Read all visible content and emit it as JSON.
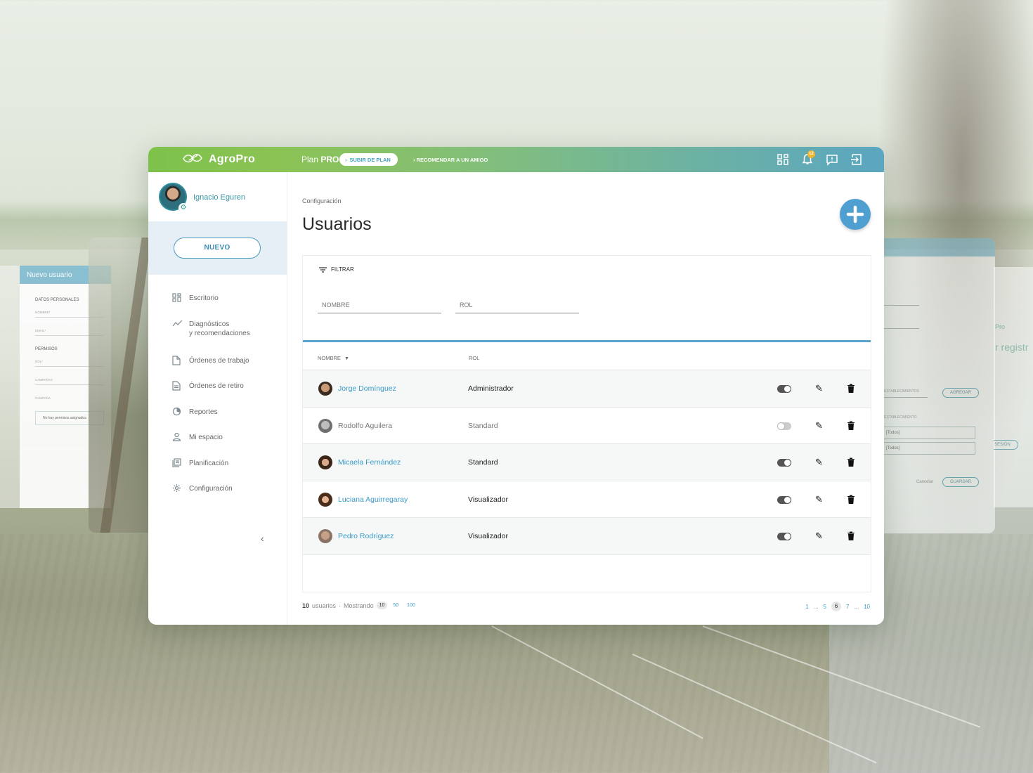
{
  "app": {
    "brand": "AgroPro",
    "plan_prefix": "Plan",
    "plan_name": "PRO",
    "upgrade_label": "SUBIR DE PLAN",
    "recommend_label": "RECOMENDAR A UN AMIGO",
    "notifications_count": "12"
  },
  "user": {
    "name": "Ignacio Eguren"
  },
  "sidebar": {
    "new_label": "NUEVO",
    "items": [
      {
        "label": "Escritorio",
        "icon": "dashboard-icon"
      },
      {
        "label": "Diagnósticos",
        "label2": "y recomendaciones",
        "icon": "trend-icon"
      },
      {
        "label": "Órdenes de trabajo",
        "icon": "document-icon"
      },
      {
        "label": "Órdenes de retiro",
        "icon": "document-list-icon"
      },
      {
        "label": "Reportes",
        "icon": "chart-pie-icon"
      },
      {
        "label": "Mi espacio",
        "icon": "person-icon"
      },
      {
        "label": "Planificación",
        "icon": "planning-icon"
      },
      {
        "label": "Configuración",
        "icon": "gear-icon"
      }
    ],
    "collapse_glyph": "‹"
  },
  "page": {
    "breadcrumb": "Configuración",
    "title": "Usuarios"
  },
  "filter": {
    "label": "FILTRAR",
    "name_placeholder": "NOMBRE",
    "role_placeholder": "ROL"
  },
  "table": {
    "col_name": "NOMBRE",
    "col_role": "ROL",
    "rows": [
      {
        "name": "Jorge Domínguez",
        "role": "Administrador",
        "active": true,
        "face": "#7a5a44"
      },
      {
        "name": "Rodolfo Aguilera",
        "role": "Standard",
        "active": false,
        "face": "#9a9a9a"
      },
      {
        "name": "Micaela Fernández",
        "role": "Standard",
        "active": true,
        "face": "#5b3b2c"
      },
      {
        "name": "Luciana Aguirregaray",
        "role": "Visualizador",
        "active": true,
        "face": "#6b4a35"
      },
      {
        "name": "Pedro Rodríguez",
        "role": "Visualizador",
        "active": true,
        "face": "#8d7665"
      }
    ]
  },
  "footer": {
    "total": "10",
    "total_label": "usuarios",
    "separator": "·",
    "showing_label": "Mostrando",
    "page_sizes": [
      "10",
      "50",
      "100"
    ],
    "pages": [
      "1",
      "...",
      "5",
      "6",
      "7",
      "...",
      "10"
    ],
    "current_page": "6"
  },
  "ghost": {
    "left_title": "Nuevo usuario",
    "left_section1": "DATOS PERSONALES",
    "left_f1": "NOMBRE*",
    "left_f2": "EMAIL*",
    "left_section2": "PERMISOS",
    "left_f3": "ROL*",
    "left_f4": "CAMPAÑAS",
    "left_f5": "CAMPAÑA",
    "left_box": "No hay permisos asignados",
    "right_f1": "ESTABLECIMIENTOS",
    "right_add": "AGREGAR",
    "right_f2": "ESTABLECIMIENTO",
    "right_box1": "[Todos]",
    "right_box2": "[Todos]",
    "right_cancel": "Cancelar",
    "right_save": "GUARDAR",
    "far_brand": "Pro",
    "far_text": "r registr",
    "far_btn": "SESIÓN"
  },
  "colors": {
    "accent": "#4f9fd0",
    "green": "#7dc24a",
    "link": "#3a9cc8"
  }
}
